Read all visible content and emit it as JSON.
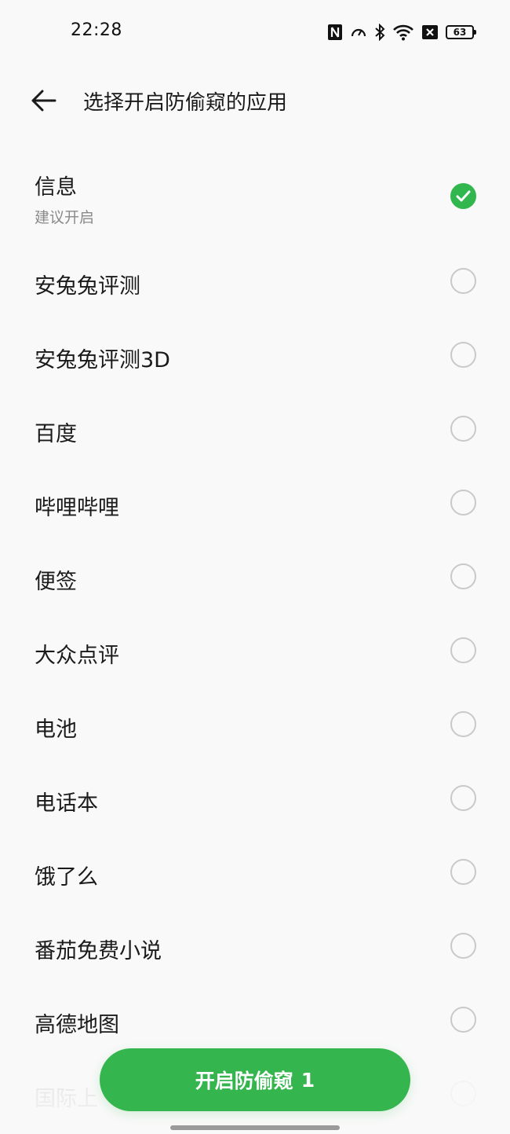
{
  "status_bar": {
    "time": "22:28",
    "battery": "63",
    "icons": [
      "nfc-icon",
      "speed-icon",
      "bluetooth-icon",
      "wifi-icon",
      "x-notification-icon",
      "battery-icon"
    ]
  },
  "header": {
    "back_icon": "back-arrow-icon",
    "title": "选择开启防偷窥的应用"
  },
  "apps": [
    {
      "name": "信息",
      "subtitle": "建议开启",
      "checked": true
    },
    {
      "name": "安兔兔评测",
      "checked": false
    },
    {
      "name": "安兔兔评测3D",
      "checked": false
    },
    {
      "name": "百度",
      "checked": false
    },
    {
      "name": "哔哩哔哩",
      "checked": false
    },
    {
      "name": "便签",
      "checked": false
    },
    {
      "name": "大众点评",
      "checked": false
    },
    {
      "name": "电池",
      "checked": false
    },
    {
      "name": "电话本",
      "checked": false
    },
    {
      "name": "饿了么",
      "checked": false
    },
    {
      "name": "番茄免费小说",
      "checked": false
    },
    {
      "name": "高德地图",
      "checked": false
    },
    {
      "name": "国际上",
      "checked": false
    }
  ],
  "enable_button": {
    "label": "开启防偷窥",
    "count": "1"
  },
  "colors": {
    "accent": "#34b54d",
    "background": "#f9f9f9",
    "unchecked_border": "#c9c9c9"
  }
}
